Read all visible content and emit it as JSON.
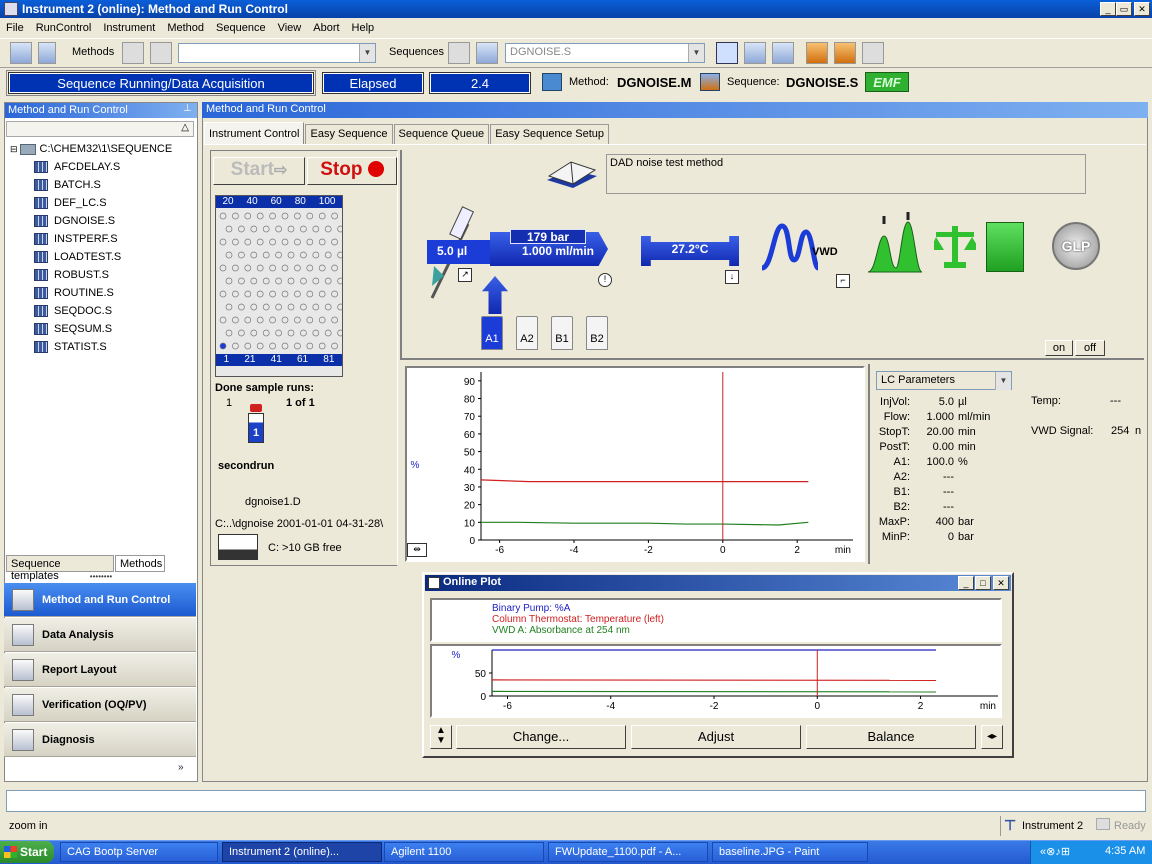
{
  "window": {
    "title": "Instrument 2 (online): Method and Run Control"
  },
  "menu": [
    "File",
    "RunControl",
    "Instrument",
    "Method",
    "Sequence",
    "View",
    "Abort",
    "Help"
  ],
  "toolbar": {
    "methods_label": "Methods",
    "sequences_label": "Sequences",
    "sequence_combo": "DGNOISE.S"
  },
  "status": {
    "state": "Sequence Running/Data Acquisition",
    "elapsed_label": "Elapsed",
    "elapsed_value": "2.4",
    "method_label": "Method:",
    "method_value": "DGNOISE.M",
    "sequence_label": "Sequence:",
    "sequence_value": "DGNOISE.S",
    "emf": "EMF"
  },
  "left_panel": {
    "header": "Method and Run Control",
    "root": "C:\\CHEM32\\1\\SEQUENCE",
    "files": [
      "AFCDELAY.S",
      "BATCH.S",
      "DEF_LC.S",
      "DGNOISE.S",
      "INSTPERF.S",
      "LOADTEST.S",
      "ROBUST.S",
      "ROUTINE.S",
      "SEQDOC.S",
      "SEQSUM.S",
      "STATIST.S"
    ],
    "tab_templates": "Sequence templates",
    "tab_methods": "Methods"
  },
  "nav": [
    {
      "label": "Method and Run Control"
    },
    {
      "label": "Data Analysis"
    },
    {
      "label": "Report Layout"
    },
    {
      "label": "Verification (OQ/PV)"
    },
    {
      "label": "Diagnosis"
    }
  ],
  "main": {
    "header": "Method and Run Control",
    "tabs": [
      "Instrument Control",
      "Easy Sequence",
      "Sequence Queue",
      "Easy Sequence Setup"
    ]
  },
  "run": {
    "start": "Start",
    "stop": "Stop",
    "tray_top": [
      "20",
      "40",
      "60",
      "80",
      "100"
    ],
    "tray_bottom": [
      "1",
      "21",
      "41",
      "61",
      "81"
    ],
    "done_label": "Done sample runs:",
    "done_count": "1",
    "done_of": "1 of 1",
    "vial_number": "1",
    "sample_name": "secondrun",
    "data_file": "dgnoise1.D",
    "path": "C:..\\dgnoise 2001-01-01 04-31-28\\",
    "disk_free": "C: >10 GB free"
  },
  "instrument": {
    "method_desc": "DAD noise test method",
    "pump_volume": "5.0 µl",
    "pump_pressure": "179 bar",
    "pump_flow": "1.000 ml/min",
    "column_temp": "27.2°C",
    "vwd_label": "VWD",
    "glp": "GLP",
    "bottles": [
      "A1",
      "A2",
      "B1",
      "B2"
    ],
    "on": "on",
    "off": "off"
  },
  "lc_params": {
    "dropdown": "LC Parameters",
    "rows": [
      {
        "label": "InjVol:",
        "value": "5.0",
        "unit": "µl"
      },
      {
        "label": "Flow:",
        "value": "1.000",
        "unit": "ml/min"
      },
      {
        "label": "StopT:",
        "value": "20.00",
        "unit": "min"
      },
      {
        "label": "PostT:",
        "value": "0.00",
        "unit": "min"
      },
      {
        "label": "A1:",
        "value": "100.0",
        "unit": "%"
      },
      {
        "label": "A2:",
        "value": "---",
        "unit": ""
      },
      {
        "label": "B1:",
        "value": "---",
        "unit": ""
      },
      {
        "label": "B2:",
        "value": "---",
        "unit": ""
      },
      {
        "label": "MaxP:",
        "value": "400",
        "unit": "bar"
      },
      {
        "label": "MinP:",
        "value": "0",
        "unit": "bar"
      }
    ],
    "temp_label": "Temp:",
    "temp_value": "---",
    "vwd_signal_label": "VWD Signal:",
    "vwd_signal_value": "254",
    "vwd_signal_unit": "n"
  },
  "online_plot": {
    "title": "Online Plot",
    "legend": [
      {
        "label": "Binary Pump: %A",
        "color": "#2020c8"
      },
      {
        "label": "Column Thermostat: Temperature (left)",
        "color": "#d02020"
      },
      {
        "label": "VWD A: Absorbance at 254 nm",
        "color": "#208020"
      }
    ],
    "buttons": {
      "change": "Change...",
      "adjust": "Adjust",
      "balance": "Balance"
    }
  },
  "chart_data": [
    {
      "type": "line",
      "ylabel": "%",
      "xlabel": "min",
      "xlim": [
        -6.5,
        3.5
      ],
      "ylim": [
        0,
        95
      ],
      "xticks": [
        "-6",
        "-4",
        "-2",
        "0",
        "2"
      ],
      "yticks": [
        "0",
        "10",
        "20",
        "30",
        "40",
        "50",
        "60",
        "70",
        "80",
        "90"
      ],
      "marker_x": 0,
      "series": [
        {
          "color": "#2020c8",
          "x": [
            -6.5,
            2.3
          ],
          "y": [
            100,
            100
          ]
        },
        {
          "color": "#d02020",
          "x": [
            -6.5,
            -5.2,
            -4,
            -2,
            0,
            2.3
          ],
          "y": [
            34,
            33,
            33,
            33,
            33,
            33
          ]
        },
        {
          "color": "#208020",
          "x": [
            -6.5,
            -5.5,
            -4,
            -2,
            -1,
            0,
            1.5,
            2.3
          ],
          "y": [
            10,
            10,
            9.5,
            9.5,
            9,
            9,
            8.5,
            10
          ]
        }
      ]
    },
    {
      "type": "line",
      "ylabel": "%",
      "xlabel": "min",
      "xlim": [
        -6.3,
        3.5
      ],
      "ylim": [
        0,
        100
      ],
      "xticks": [
        "-6",
        "-4",
        "-2",
        "0",
        "2"
      ],
      "yticks": [
        "0",
        "50"
      ],
      "marker_x": 0,
      "series": [
        {
          "color": "#2020c8",
          "x": [
            -6.3,
            2.3
          ],
          "y": [
            100,
            100
          ]
        },
        {
          "color": "#d02020",
          "x": [
            -6.3,
            2.3
          ],
          "y": [
            35,
            34
          ]
        },
        {
          "color": "#208020",
          "x": [
            -6.3,
            2.3
          ],
          "y": [
            10,
            9
          ]
        }
      ]
    }
  ],
  "status_bar": {
    "message": "zoom in",
    "instrument": "Instrument 2",
    "ready": "Ready"
  },
  "taskbar": {
    "start": "Start",
    "tasks": [
      "CAG Bootp Server",
      "Instrument 2 (online)...",
      "Agilent 1100",
      "FWUpdate_1100.pdf - A...",
      "baseline.JPG - Paint"
    ],
    "clock": "4:35 AM"
  }
}
